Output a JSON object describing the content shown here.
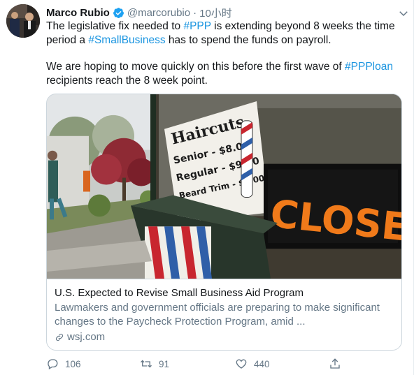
{
  "tweet": {
    "author_name": "Marco Rubio",
    "handle": "@marcorubio",
    "separator": "·",
    "time": "10小时",
    "text": {
      "line1_a": "The legislative fix needed to ",
      "line1_tag": "#PPP",
      "line1_b": " is extending beyond 8 weeks the time period a ",
      "line1_tag2": "#SmallBusiness",
      "line1_c": " has to spend the funds on payroll.",
      "line2_a": "We are hoping to move quickly on this before the first wave of ",
      "line2_tag": "#PPPloan",
      "line2_b": " recipients reach the 8 week point."
    },
    "card": {
      "title": "U.S. Expected to Revise Small Business Aid Program",
      "description": "Lawmakers and government officials are preparing to make significant changes to the Paycheck Protection Program, amid ...",
      "domain": "wsj.com",
      "image": {
        "sign_haircuts": "Haircuts",
        "sign_line1": "Senior - $8.00",
        "sign_line2": "Regular - $9.00",
        "sign_line3": "Beard Trim - $6.00",
        "closed": "CLOSED"
      }
    },
    "actions": {
      "reply_count": "106",
      "retweet_count": "91",
      "like_count": "440"
    }
  },
  "colors": {
    "link": "#1b95e0",
    "secondary_text": "#657786",
    "primary_text": "#14171a",
    "border": "#ccd6dd",
    "verified": "#1da1f2"
  }
}
